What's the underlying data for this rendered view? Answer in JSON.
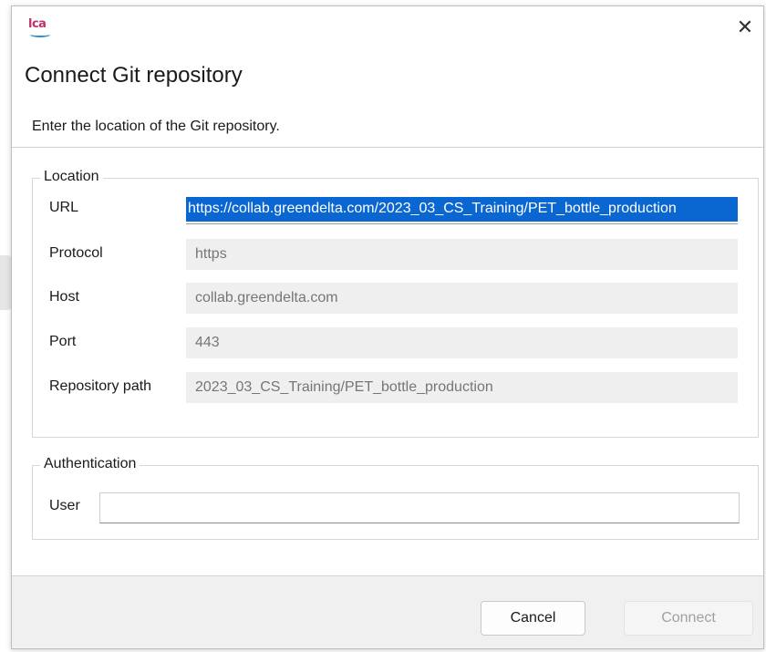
{
  "dialog": {
    "title": "Connect Git repository",
    "subtitle": "Enter the location of the Git repository.",
    "close_glyph": "✕",
    "app_logo_text": "LCA"
  },
  "location": {
    "legend": "Location",
    "url_label": "URL",
    "url_value": "https://collab.greendelta.com/2023_03_CS_Training/PET_bottle_production",
    "protocol_label": "Protocol",
    "protocol_value": "https",
    "host_label": "Host",
    "host_value": "collab.greendelta.com",
    "port_label": "Port",
    "port_value": "443",
    "path_label": "Repository path",
    "path_value": "2023_03_CS_Training/PET_bottle_production"
  },
  "authentication": {
    "legend": "Authentication",
    "user_label": "User",
    "user_value": ""
  },
  "footer": {
    "cancel_label": "Cancel",
    "connect_label": "Connect"
  },
  "colors": {
    "selection": "#0a66d1",
    "logo_primary": "#c0306b",
    "logo_accent": "#2f8ccf"
  },
  "icons": {
    "logo": "openlca-logo-icon",
    "close": "close-icon"
  }
}
